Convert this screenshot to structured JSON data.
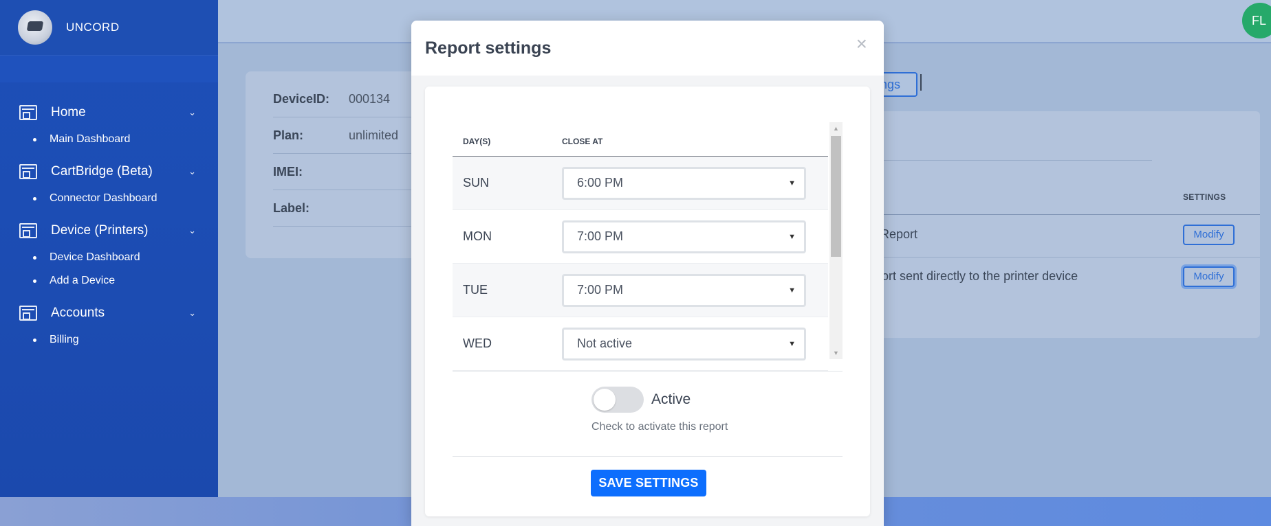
{
  "sidebar": {
    "brand": "UNCORD",
    "groups": [
      {
        "label": "Home",
        "items": [
          "Main Dashboard"
        ]
      },
      {
        "label": "CartBridge (Beta)",
        "items": [
          "Connector Dashboard"
        ]
      },
      {
        "label": "Device (Printers)",
        "items": [
          "Device Dashboard",
          "Add a Device"
        ]
      },
      {
        "label": "Accounts",
        "items": [
          "Billing"
        ]
      }
    ]
  },
  "header": {
    "avatar_initials": "FL"
  },
  "device": {
    "rows": [
      {
        "key": "DeviceID:",
        "value": "000134"
      },
      {
        "key": "Plan:",
        "value": "unlimited"
      },
      {
        "key": "IMEI:",
        "value": ""
      },
      {
        "key": "Label:",
        "value": ""
      }
    ]
  },
  "background_panel": {
    "tab_button": "ngs",
    "settings_header": "SETTINGS",
    "row1_text": "Report",
    "row2_text": "port sent directly to the printer device",
    "modify_label": "Modify"
  },
  "modal": {
    "title": "Report settings",
    "close_glyph": "×",
    "table": {
      "col_day": "DAY(S)",
      "col_close": "CLOSE AT",
      "rows": [
        {
          "day": "SUN",
          "close_at": "6:00 PM"
        },
        {
          "day": "MON",
          "close_at": "7:00 PM"
        },
        {
          "day": "TUE",
          "close_at": "7:00 PM"
        },
        {
          "day": "WED",
          "close_at": "Not active"
        }
      ]
    },
    "toggle": {
      "label": "Active",
      "checked": false,
      "help": "Check to activate this report"
    },
    "save_label": "SAVE SETTINGS"
  },
  "colors": {
    "sidebar": "#1d4fb8",
    "primary": "#0d6efd",
    "avatar": "#26a96a"
  }
}
